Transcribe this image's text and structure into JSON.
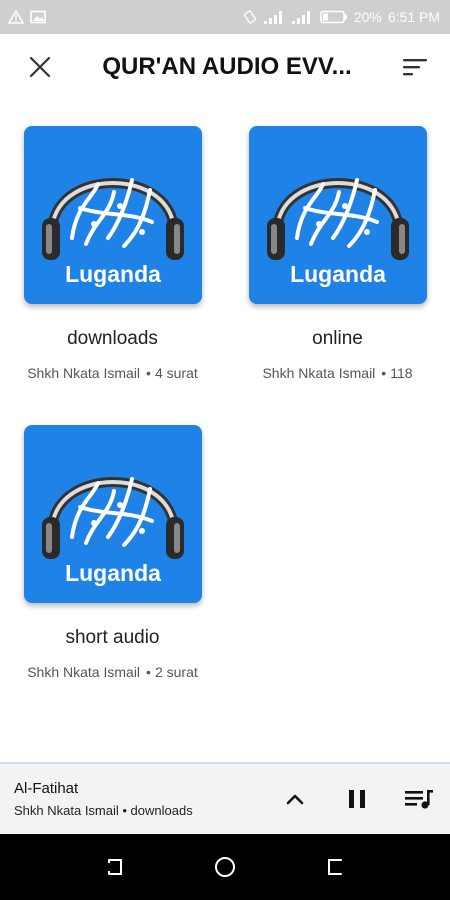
{
  "status_bar": {
    "battery": "20%",
    "time": "6:51 PM"
  },
  "app_bar": {
    "title": "QUR'AN AUDIO EVV...",
    "close_icon": "close-icon",
    "sort_icon": "sort-icon"
  },
  "albums": [
    {
      "thumb_label": "Luganda",
      "title": "downloads",
      "artist": "Shkh Nkata Ismail",
      "dot": "•",
      "count": "4 surat"
    },
    {
      "thumb_label": "Luganda",
      "title": "online",
      "artist": "Shkh Nkata Ismail",
      "dot": "•",
      "count": "118"
    },
    {
      "thumb_label": "Luganda",
      "title": "short audio",
      "artist": "Shkh Nkata Ismail",
      "dot": "•",
      "count": "2 surat"
    }
  ],
  "mini_player": {
    "title": "Al-Fatihat",
    "subtitle": "Shkh Nkata Ismail • downloads",
    "state": "playing"
  },
  "colors": {
    "thumb_bg": "#1f82e6",
    "status_bar": "#cfcfcf",
    "nav_bar": "#000000"
  }
}
